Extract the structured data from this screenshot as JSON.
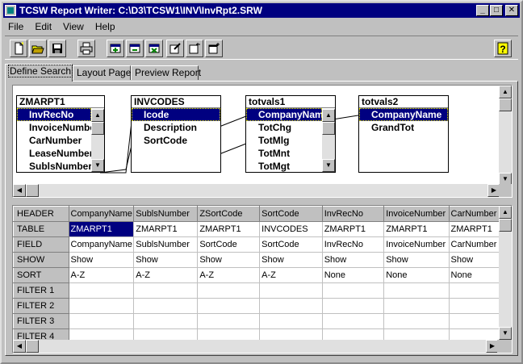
{
  "window": {
    "title": "TCSW Report Writer: C:\\D3\\TCSW1\\INV\\InvRpt2.SRW",
    "minimize": "_",
    "maximize": "□",
    "close": "✕"
  },
  "menu": [
    "File",
    "Edit",
    "View",
    "Help"
  ],
  "toolbar": [
    {
      "name": "new-icon"
    },
    {
      "name": "open-folder-icon"
    },
    {
      "name": "save-disk-icon"
    },
    {
      "name": "print-icon"
    },
    {
      "name": "add-table-icon"
    },
    {
      "name": "remove-table-icon"
    },
    {
      "name": "delete-table-icon"
    },
    {
      "name": "edit-properties-icon"
    },
    {
      "name": "new-item-icon"
    },
    {
      "name": "window-icon"
    },
    {
      "name": "help-icon"
    }
  ],
  "tabs": [
    "Define Search",
    "Layout Page",
    "Preview Report"
  ],
  "tables": [
    {
      "name": "ZMARPT1",
      "fields": [
        "InvRecNo",
        "InvoiceNumber",
        "CarNumber",
        "LeaseNumber",
        "SublsNumber"
      ],
      "selected": 0
    },
    {
      "name": "INVCODES",
      "fields": [
        "Icode",
        "Description",
        "SortCode"
      ],
      "selected": 0
    },
    {
      "name": "totvals1",
      "fields": [
        "CompanyName",
        "TotChg",
        "TotMlg",
        "TotMnt",
        "TotMgt"
      ],
      "selected": 0
    },
    {
      "name": "totvals2",
      "fields": [
        "CompanyName",
        "GrandTot"
      ],
      "selected": 0
    }
  ],
  "grid": {
    "row_headers": [
      "HEADER",
      "TABLE",
      "FIELD",
      "SHOW",
      "SORT",
      "FILTER 1",
      "FILTER 2",
      "FILTER 3",
      "FILTER 4"
    ],
    "columns": [
      {
        "header": "CompanyName",
        "table": "ZMARPT1",
        "field": "CompanyName",
        "show": "Show",
        "sort": "A-Z"
      },
      {
        "header": "SublsNumber",
        "table": "ZMARPT1",
        "field": "SublsNumber",
        "show": "Show",
        "sort": "A-Z"
      },
      {
        "header": "ZSortCode",
        "table": "ZMARPT1",
        "field": "SortCode",
        "show": "Show",
        "sort": "A-Z"
      },
      {
        "header": "SortCode",
        "table": "INVCODES",
        "field": "SortCode",
        "show": "Show",
        "sort": "A-Z"
      },
      {
        "header": "InvRecNo",
        "table": "ZMARPT1",
        "field": "InvRecNo",
        "show": "Show",
        "sort": "None"
      },
      {
        "header": "InvoiceNumber",
        "table": "ZMARPT1",
        "field": "InvoiceNumber",
        "show": "Show",
        "sort": "None"
      },
      {
        "header": "CarNumber",
        "table": "ZMARPT1",
        "field": "CarNumber",
        "show": "Show",
        "sort": "None"
      }
    ],
    "selected_cell": {
      "row": "TABLE",
      "column": 0
    }
  },
  "colors": {
    "titlebar": "#000080",
    "selection": "#000080",
    "face": "#c0c0c0"
  }
}
